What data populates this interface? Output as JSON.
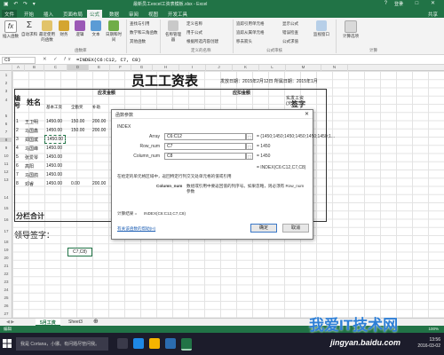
{
  "window": {
    "title": "最新员工excel工资表模板.xlsx - Excel",
    "account": "登录",
    "share": "共享"
  },
  "tabs": [
    "文件",
    "开始",
    "插入",
    "页面布局",
    "公式",
    "数据",
    "审阅",
    "视图",
    "开发工具"
  ],
  "active_tab": "公式",
  "ribbon": {
    "buttons": [
      {
        "label": "插入函数",
        "icon": "function-icon"
      },
      {
        "label": "自动求和",
        "icon": "sum-icon"
      },
      {
        "label": "最近使用的函数",
        "icon": "recent-icon"
      },
      {
        "label": "财务",
        "icon": "finance-icon"
      },
      {
        "label": "逻辑",
        "icon": "logic-icon"
      },
      {
        "label": "文本",
        "icon": "text-icon"
      },
      {
        "label": "日期和时间",
        "icon": "date-icon"
      },
      {
        "label": "查找与引用",
        "icon": "lookup-icon"
      },
      {
        "label": "数学和三角函数",
        "icon": "math-icon"
      },
      {
        "label": "其他函数",
        "icon": "more-icon"
      },
      {
        "label": "名称管理器",
        "icon": "names-icon"
      },
      {
        "label": "监视窗口",
        "icon": "watch-icon"
      },
      {
        "label": "计算选项",
        "icon": "calc-icon"
      }
    ],
    "small": [
      "定义名称",
      "用于公式",
      "根据所选内容创建",
      "追踪引用单元格",
      "追踪从属单元格",
      "移去箭头",
      "显示公式",
      "错误检查",
      "公式求值"
    ],
    "groups": [
      "函数库",
      "定义的名称",
      "公式审核",
      "计算"
    ]
  },
  "formula_bar": {
    "name_box": "C9",
    "formula": "=INDEX(C6:C12, C7, C8)"
  },
  "columns": [
    "A",
    "B",
    "C",
    "D",
    "E",
    "F",
    "G",
    "H",
    "I",
    "J",
    "K",
    "L",
    "M",
    "N"
  ],
  "rows": [
    "1",
    "2",
    "3",
    "4",
    "5",
    "6",
    "7",
    "8",
    "9",
    "10",
    "11",
    "12",
    "13",
    "14",
    "15",
    "16",
    "17",
    "18",
    "19",
    "20",
    "21",
    "22",
    "23",
    "24",
    "25",
    "26",
    "27",
    "28"
  ],
  "sheet": {
    "title": "员工工资表",
    "pay_date": "发放日期：2015年2月12日  所属日期：2015年1月",
    "header_no": "编号",
    "header_name": "姓名",
    "header_payable": "应发金额",
    "header_deduct": "应扣金额",
    "header_actual": "实发工资(元)",
    "header_sign": "签字",
    "subheaders": [
      "基本工资",
      "全勤奖",
      "补助",
      "奖金",
      "合计(元)",
      "事假扣款",
      "病假扣款",
      "迟到扣款",
      "应扣合计"
    ],
    "employees": [
      {
        "no": "1",
        "name": "王卫明",
        "base": "1450.00",
        "full": "150.00",
        "sub": "200.00"
      },
      {
        "no": "2",
        "name": "马国鑫",
        "base": "1450.00",
        "full": "150.00",
        "sub": "200.00"
      },
      {
        "no": "3",
        "name": "郑国斌",
        "base": "1450.00",
        "full": "",
        "sub": ""
      },
      {
        "no": "4",
        "name": "马国峰",
        "base": "1450.00",
        "full": "",
        "sub": ""
      },
      {
        "no": "5",
        "name": "张爱琴",
        "base": "1450.00",
        "full": "",
        "sub": ""
      },
      {
        "no": "6",
        "name": "高阳",
        "base": "1450.00",
        "full": "",
        "sub": ""
      },
      {
        "no": "7",
        "name": "马国鸽",
        "base": "1450.00",
        "full": "",
        "sub": ""
      },
      {
        "no": "8",
        "name": "邓睿",
        "base": "1450.00",
        "full": "0.00",
        "sub": "200.00"
      }
    ],
    "subtotal": "分栏合计",
    "leader_sign": "领导签字：",
    "active_cell_text": "C7,C8)"
  },
  "dialog": {
    "title": "函数参数",
    "function": "INDEX",
    "args": [
      {
        "label": "Array",
        "value": "C6:C12",
        "result": "= {1450;1450;1450;1450;1450;1450;1..."
      },
      {
        "label": "Row_num",
        "value": "C7",
        "result": "= 1450"
      },
      {
        "label": "Column_num",
        "value": "C8",
        "result": "= 1450"
      }
    ],
    "formula_result": "= INDEX(C6:C12,C7,C8)",
    "description": "在给定的单元格区域中，返回特定行列交叉处单元格的值或引用",
    "arg_help_label": "Column_num",
    "arg_help": "数组或引用中要返回值的列序号。如果忽略，则必须有 Row_num 参数",
    "calc_result_label": "计算结果 =",
    "calc_result": "INDEX(C6:C12,C7,C8)",
    "help_link": "有关该函数的帮助(H)",
    "ok": "确定",
    "cancel": "取消"
  },
  "sheet_tabs": [
    "5月工资",
    "Sheet3"
  ],
  "active_sheet": "5月工资",
  "status": {
    "left": "编辑",
    "right": "100%"
  },
  "taskbar": {
    "search_placeholder": "我是 Cortana，小娜。有问题尽管问我。",
    "time": "13:56",
    "date": "2016-03-02"
  },
  "watermark": {
    "brand": "我爱IT技术网",
    "site": "jingyan.baidu.com"
  },
  "colors": {
    "excel_green": "#217346",
    "dialog_link": "#1e5fb4",
    "watermark_blue": "#2e7fd6"
  }
}
